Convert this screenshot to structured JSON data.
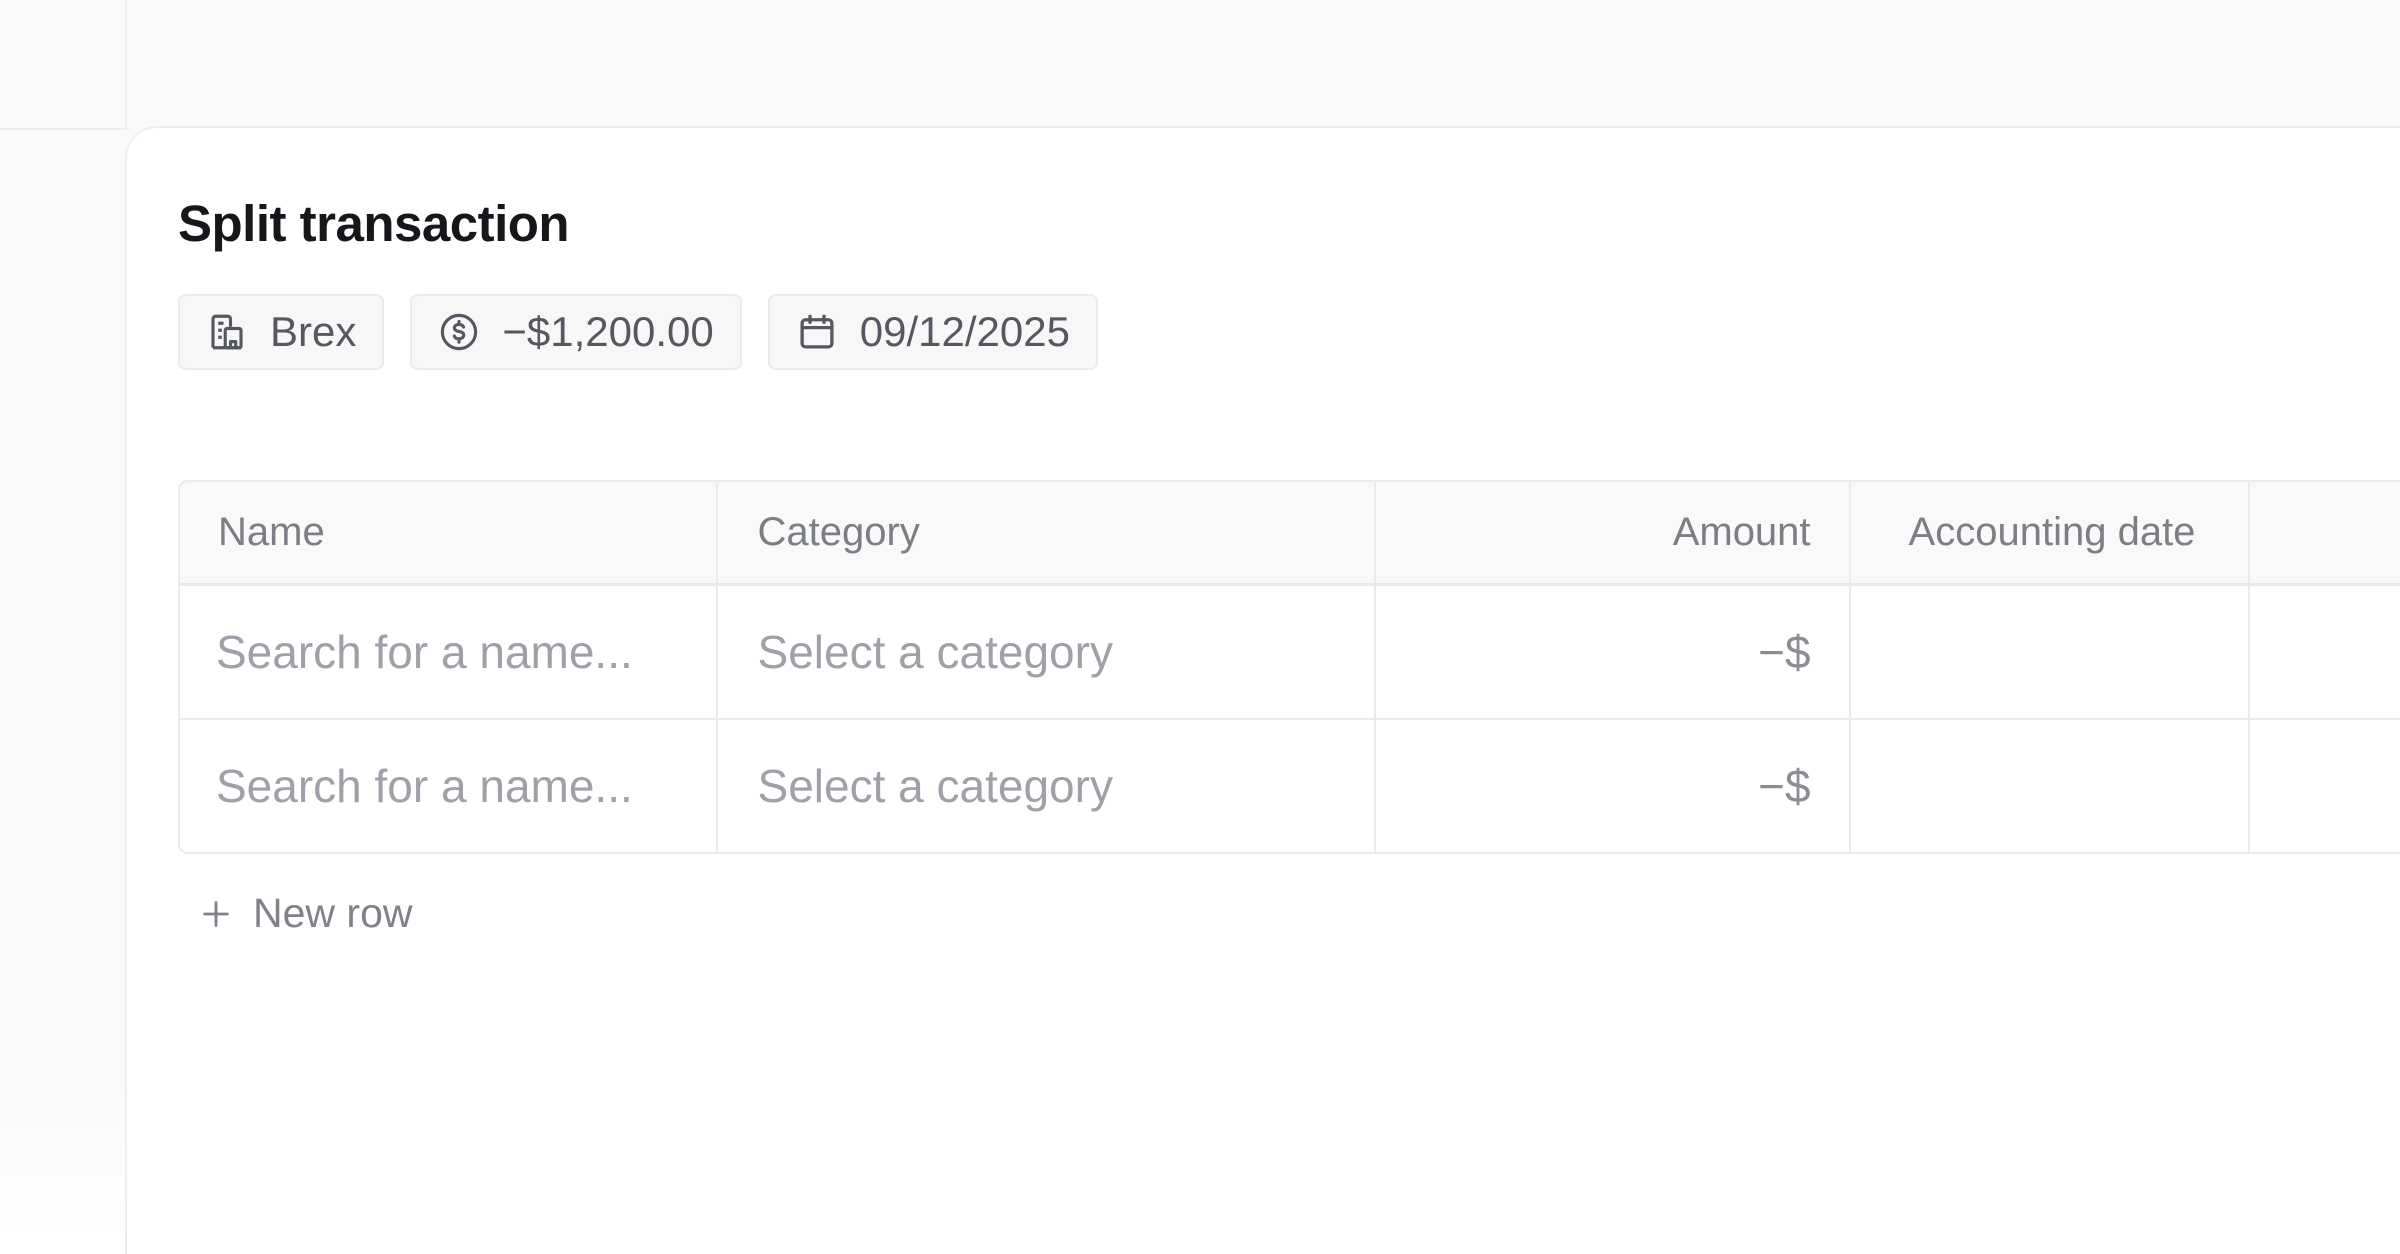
{
  "page": {
    "title": "Split transaction"
  },
  "chips": {
    "merchant": "Brex",
    "amount": "−$1,200.00",
    "date": "09/12/2025"
  },
  "table": {
    "columns": {
      "name": "Name",
      "category": "Category",
      "amount": "Amount",
      "accounting_date": "Accounting date"
    },
    "rows": [
      {
        "name_placeholder": "Search for a name...",
        "category_placeholder": "Select a category",
        "amount_prefix": "−$",
        "accounting_date": ""
      },
      {
        "name_placeholder": "Search for a name...",
        "category_placeholder": "Select a category",
        "amount_prefix": "−$",
        "accounting_date": ""
      }
    ]
  },
  "actions": {
    "new_row_label": "New row"
  },
  "icons": {
    "merchant": "building-icon",
    "amount": "dollar-circle-icon",
    "date": "calendar-icon",
    "new_row": "plus-icon"
  },
  "colors": {
    "title": "#16171b",
    "chip_background": "#f7f7f7",
    "placeholder_text": "#9ea1a7",
    "border": "#ebebeb"
  }
}
